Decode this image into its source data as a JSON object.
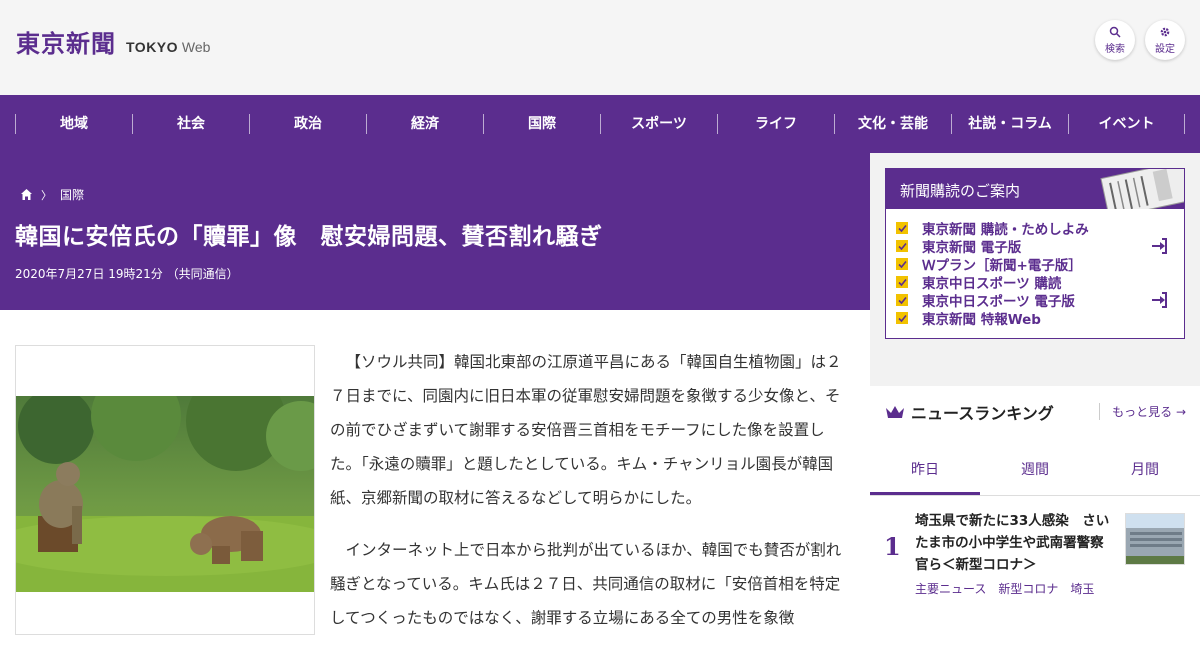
{
  "header": {
    "logo_jp": "東京新聞",
    "logo_en_bold": "TOKYO",
    "logo_en_light": "Web",
    "search_label": "検索",
    "settings_label": "設定"
  },
  "nav": {
    "items": [
      "地域",
      "社会",
      "政治",
      "経済",
      "国際",
      "スポーツ",
      "ライフ",
      "文化・芸能",
      "社説・コラム",
      "イベント"
    ]
  },
  "article": {
    "breadcrumb": "国際",
    "title": "韓国に安倍氏の「贖罪」像　慰安婦問題、賛否割れ騒ぎ",
    "dateline": "2020年7月27日 19時21分 （共同通信）",
    "paragraphs": [
      "【ソウル共同】韓国北東部の江原道平昌にある「韓国自生植物園」は２７日までに、同園内に旧日本軍の従軍慰安婦問題を象徴する少女像と、その前でひざまずいて謝罪する安倍晋三首相をモチーフにした像を設置した。「永遠の贖罪」と題したとしている。キム・チャンリョル園長が韓国紙、京郷新聞の取材に答えるなどして明らかにした。",
      "インターネット上で日本から批判が出ているほか、韓国でも賛否が割れ騒ぎとなっている。キム氏は２７日、共同通信の取材に「安倍首相を特定してつくったものではなく、謝罪する立場にある全ての男性を象徴"
    ]
  },
  "sidebar": {
    "subscription": {
      "title": "新聞購読のご案内",
      "items": [
        {
          "label": "東京新聞 購読・ためしよみ",
          "arrow": false
        },
        {
          "label": "東京新聞 電子版",
          "arrow": true
        },
        {
          "label": "Ｗプラン［新聞+電子版］",
          "arrow": false
        },
        {
          "label": "東京中日スポーツ 購読",
          "arrow": false
        },
        {
          "label": "東京中日スポーツ 電子版",
          "arrow": true
        },
        {
          "label": "東京新聞 特報Web",
          "arrow": false
        }
      ]
    },
    "ranking": {
      "title": "ニュースランキング",
      "more": "もっと見る",
      "tabs": [
        "昨日",
        "週間",
        "月間"
      ],
      "active_tab": 0,
      "items": [
        {
          "rank": "1",
          "title": "埼玉県で新たに33人感染　さいたま市の小中学生や武南署警察官ら＜新型コロナ＞",
          "tags": [
            "主要ニュース",
            "新型コロナ",
            "埼玉"
          ]
        }
      ]
    }
  },
  "colors": {
    "brand_purple": "#5b2d8e",
    "check_yellow": "#f2c200"
  }
}
